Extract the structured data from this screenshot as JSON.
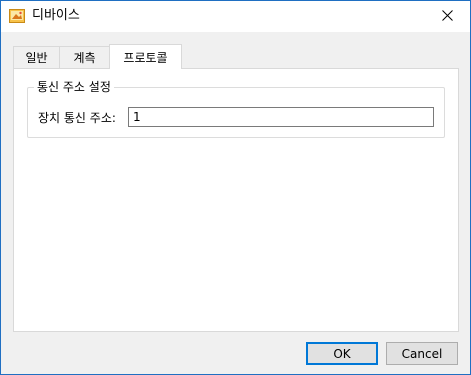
{
  "window": {
    "title": "디바이스"
  },
  "tabs": [
    {
      "label": "일반",
      "active": false
    },
    {
      "label": "계측",
      "active": false
    },
    {
      "label": "프로토콜",
      "active": true
    }
  ],
  "protocol": {
    "group_title": "통신 주소 설정",
    "address_label": "장치 통신 주소:",
    "address_value": "1"
  },
  "buttons": {
    "ok_label": "OK",
    "cancel_label": "Cancel"
  },
  "colors": {
    "accent": "#0078d7",
    "window_border": "#1f6fc2",
    "dialog_bg": "#f0f0f0"
  },
  "icons": {
    "app_icon": "device-app-icon",
    "close": "close-icon"
  }
}
